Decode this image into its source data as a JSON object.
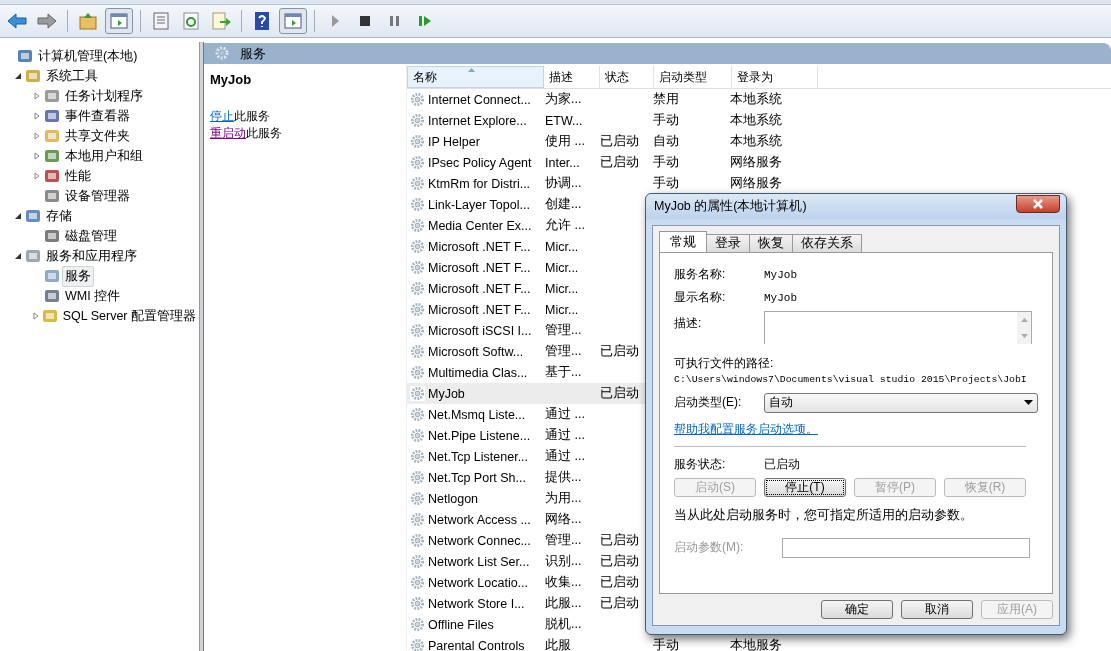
{
  "tree": [
    {
      "label": "计算机管理(本地)",
      "selected": false,
      "children": [
        {
          "label": "系统工具",
          "expanded": true,
          "selected": false,
          "children": [
            {
              "label": "任务计划程序",
              "expanded": false,
              "selected": false
            },
            {
              "label": "事件查看器",
              "expanded": false,
              "selected": false
            },
            {
              "label": "共享文件夹",
              "expanded": false,
              "selected": false
            },
            {
              "label": "本地用户和组",
              "expanded": false,
              "selected": false
            },
            {
              "label": "性能",
              "expanded": false,
              "selected": false
            },
            {
              "label": "设备管理器",
              "selected": false
            }
          ]
        },
        {
          "label": "存储",
          "expanded": true,
          "selected": false,
          "children": [
            {
              "label": "磁盘管理",
              "selected": false
            }
          ]
        },
        {
          "label": "服务和应用程序",
          "expanded": true,
          "selected": false,
          "children": [
            {
              "label": "服务",
              "selected": true
            },
            {
              "label": "WMI 控件",
              "selected": false
            },
            {
              "label": "SQL Server 配置管理器",
              "expanded": false,
              "selected": false
            }
          ]
        }
      ]
    }
  ],
  "header": {
    "title": "服务"
  },
  "actions": {
    "title": "MyJob",
    "links": [
      {
        "link": "停止",
        "rest": "此服务",
        "visited": false
      },
      {
        "link": "重启动",
        "rest": "此服务",
        "visited": true
      }
    ]
  },
  "table": {
    "columns": [
      "名称",
      "描述",
      "状态",
      "启动类型",
      "登录为"
    ],
    "rows": [
      {
        "name": "Internet Connect...",
        "description": "为家...",
        "startup": "禁用",
        "logon": "本地系统",
        "selected": false
      },
      {
        "name": "Internet Explore...",
        "description": "ETW...",
        "startup": "手动",
        "logon": "本地系统",
        "selected": false
      },
      {
        "name": "IP Helper",
        "description": "使用 ...",
        "status": "已启动",
        "startup": "自动",
        "logon": "本地系统",
        "selected": false
      },
      {
        "name": "IPsec Policy Agent",
        "description": "Inter...",
        "status": "已启动",
        "startup": "手动",
        "logon": "网络服务",
        "selected": false
      },
      {
        "name": "KtmRm for Distri...",
        "description": "协调...",
        "startup": "手动",
        "logon": "网络服务",
        "selected": false
      },
      {
        "name": "Link-Layer Topol...",
        "description": "创建...",
        "selected": false
      },
      {
        "name": "Media Center Ex...",
        "description": "允许 ...",
        "selected": false
      },
      {
        "name": "Microsoft .NET F...",
        "description": "Micr...",
        "selected": false
      },
      {
        "name": "Microsoft .NET F...",
        "description": "Micr...",
        "selected": false
      },
      {
        "name": "Microsoft .NET F...",
        "description": "Micr...",
        "selected": false
      },
      {
        "name": "Microsoft .NET F...",
        "description": "Micr...",
        "selected": false
      },
      {
        "name": "Microsoft iSCSI I...",
        "description": "管理...",
        "selected": false
      },
      {
        "name": "Microsoft Softw...",
        "description": "管理...",
        "status": "已启动",
        "selected": false
      },
      {
        "name": "Multimedia Clas...",
        "description": "基于...",
        "selected": false
      },
      {
        "name": "MyJob",
        "status": "已启动",
        "selected": true
      },
      {
        "name": "Net.Msmq Liste...",
        "description": "通过 ...",
        "selected": false
      },
      {
        "name": "Net.Pipe Listene...",
        "description": "通过 ...",
        "selected": false
      },
      {
        "name": "Net.Tcp Listener...",
        "description": "通过 ...",
        "selected": false
      },
      {
        "name": "Net.Tcp Port Sh...",
        "description": "提供...",
        "selected": false
      },
      {
        "name": "Netlogon",
        "description": "为用...",
        "selected": false
      },
      {
        "name": "Network Access ...",
        "description": "网络...",
        "selected": false
      },
      {
        "name": "Network Connec...",
        "description": "管理...",
        "status": "已启动",
        "selected": false
      },
      {
        "name": "Network List Ser...",
        "description": "识别...",
        "status": "已启动",
        "selected": false
      },
      {
        "name": "Network Locatio...",
        "description": "收集...",
        "status": "已启动",
        "selected": false
      },
      {
        "name": "Network Store I...",
        "description": "此服...",
        "status": "已启动",
        "selected": false
      },
      {
        "name": "Offline Files",
        "description": "脱机...",
        "selected": false
      },
      {
        "name": "Parental Controls",
        "description": "此服",
        "startup": "手动",
        "logon": "本地服务",
        "selected": false
      }
    ]
  },
  "dialog": {
    "title": "MyJob 的属性(本地计算机)",
    "tabs": [
      {
        "label": "常规",
        "selected": true
      },
      {
        "label": "登录",
        "selected": false
      },
      {
        "label": "恢复",
        "selected": false
      },
      {
        "label": "依存关系",
        "selected": false
      }
    ],
    "service_name": {
      "label": "服务名称:",
      "value": "MyJob"
    },
    "display_name": {
      "label": "显示名称:",
      "value": "MyJob"
    },
    "description": {
      "label": "描述:"
    },
    "path": {
      "label": "可执行文件的路径:",
      "value": "C:\\Users\\windows7\\Documents\\visual studio 2015\\Projects\\JobI"
    },
    "startup_type": {
      "label": "启动类型(E):",
      "value": "自动"
    },
    "help_link": "帮助我配置服务启动选项。",
    "status": {
      "label": "服务状态:",
      "value": "已启动"
    },
    "control_buttons": [
      {
        "label": "启动(S)",
        "disabled": true
      },
      {
        "label": "停止(T)",
        "disabled": false
      },
      {
        "label": "暂停(P)",
        "disabled": true
      },
      {
        "label": "恢复(R)",
        "disabled": true
      }
    ],
    "note": "当从此处启动服务时，您可指定所适用的启动参数。",
    "parameters": {
      "label": "启动参数(M):",
      "disabled": true
    },
    "buttons": [
      {
        "label": "确定",
        "disabled": false
      },
      {
        "label": "取消",
        "disabled": false
      },
      {
        "label": "应用(A)",
        "disabled": true
      }
    ]
  }
}
